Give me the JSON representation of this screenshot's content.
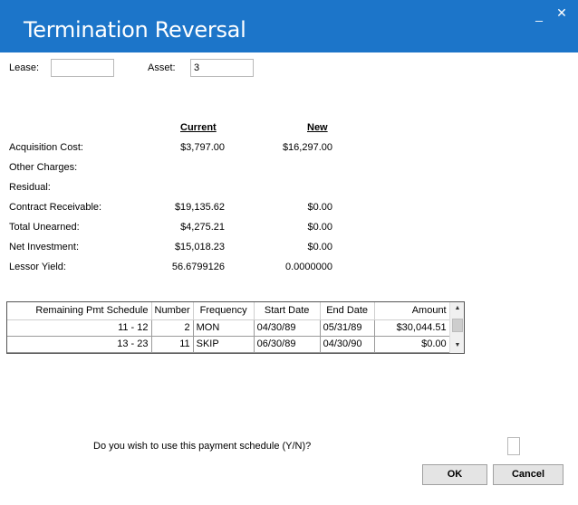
{
  "window": {
    "title": "Termination Reversal",
    "minimize_glyph": "_",
    "close_glyph": "✕"
  },
  "form": {
    "lease_label": "Lease:",
    "lease_value": "",
    "asset_label": "Asset:",
    "asset_value": "3"
  },
  "comparison": {
    "current_header": "Current",
    "new_header": "New",
    "rows": [
      {
        "label": "Acquisition Cost:",
        "current": "$3,797.00",
        "new": "$16,297.00"
      },
      {
        "label": "Other Charges:",
        "current": "",
        "new": ""
      },
      {
        "label": "Residual:",
        "current": "",
        "new": ""
      },
      {
        "label": "Contract Receivable:",
        "current": "$19,135.62",
        "new": "$0.00"
      },
      {
        "label": "Total Unearned:",
        "current": "$4,275.21",
        "new": "$0.00"
      },
      {
        "label": "Net Investment:",
        "current": "$15,018.23",
        "new": "$0.00"
      },
      {
        "label": "Lessor Yield:",
        "current": "56.6799126",
        "new": "0.0000000"
      }
    ]
  },
  "schedule": {
    "columns": [
      "Remaining Pmt Schedule",
      "Number",
      "Frequency",
      "Start Date",
      "End Date",
      "Amount"
    ],
    "rows": [
      [
        "11 -  12",
        "2",
        "MON",
        "04/30/89",
        "05/31/89",
        "$30,044.51"
      ],
      [
        "13 -  23",
        "11",
        "SKIP",
        "06/30/89",
        "04/30/90",
        "$0.00"
      ]
    ]
  },
  "prompt": {
    "question": "Do you wish to use this payment schedule (Y/N)?",
    "answer_value": ""
  },
  "buttons": {
    "ok": "OK",
    "cancel": "Cancel"
  }
}
